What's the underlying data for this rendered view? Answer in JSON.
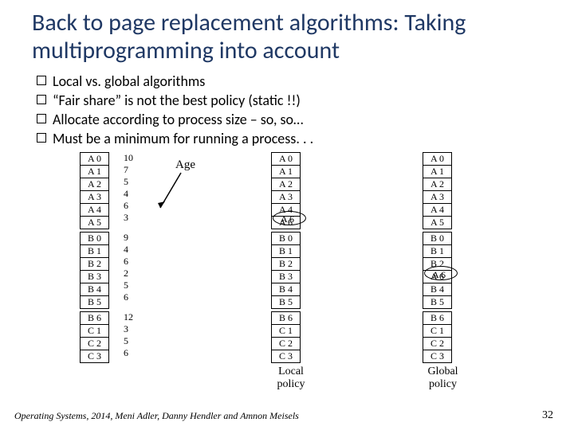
{
  "title": "Back to page replacement algorithms: Taking multiprogramming into account",
  "bullets": [
    "Local vs. global algorithms",
    "“Fair share” is not the best policy (static !!)",
    "Allocate according to process size – so, so…",
    "Must be a minimum for running a process. . ."
  ],
  "diagram": {
    "age_label": "Age",
    "col1": {
      "A": [
        "A 0",
        "A 1",
        "A 2",
        "A 3",
        "A 4",
        "A 5"
      ],
      "B": [
        "B 0",
        "B 1",
        "B 2",
        "B 3",
        "B 4",
        "B 5"
      ],
      "C": [
        "B 6",
        "C 1",
        "C 2",
        "C 3"
      ]
    },
    "ages": {
      "A": [
        "10",
        "7",
        "5",
        "4",
        "6",
        "3"
      ],
      "B": [
        "9",
        "4",
        "6",
        "2",
        "5",
        "6"
      ],
      "C": [
        "12",
        "3",
        "5",
        "6"
      ]
    },
    "col2": {
      "A": [
        "A 0",
        "A 1",
        "A 2",
        "A 3",
        "A 4",
        "A 6"
      ],
      "B": [
        "B 0",
        "B 1",
        "B 2",
        "B 3",
        "B 4",
        "B 5"
      ],
      "C": [
        "B 6",
        "C 1",
        "C 2",
        "C 3"
      ]
    },
    "col3": {
      "A": [
        "A 0",
        "A 1",
        "A 2",
        "A 3",
        "A 4",
        "A 5"
      ],
      "B": [
        "B 0",
        "B 1",
        "B 2",
        "A 6",
        "B 4",
        "B 5"
      ],
      "C": [
        "B 6",
        "C 1",
        "C 2",
        "C 3"
      ]
    },
    "anno_a6_top": "A 6",
    "anno_a6_mid": "A 6",
    "local_label": "Local\npolicy",
    "global_label": "Global\npolicy"
  },
  "footer": "Operating Systems, 2014, Meni Adler, Danny Hendler and Amnon Meisels",
  "page_number": "32"
}
